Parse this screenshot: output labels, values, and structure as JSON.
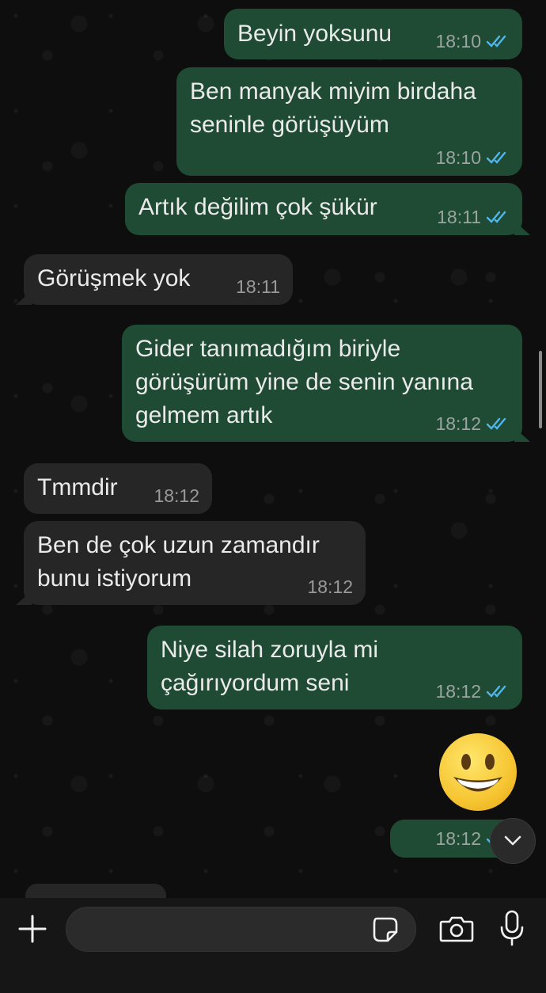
{
  "messages": [
    {
      "text": "Beyin yoksunu",
      "time": "18:10",
      "direction": "outgoing",
      "read": true
    },
    {
      "text": "Ben manyak miyim birdaha\nseninle görüşüyüm",
      "time": "18:10",
      "direction": "outgoing",
      "read": true
    },
    {
      "text": "Artık değilim çok şükür",
      "time": "18:11",
      "direction": "outgoing",
      "read": true
    },
    {
      "text": "Görüşmek yok",
      "time": "18:11",
      "direction": "incoming"
    },
    {
      "text": "Gider tanımadığım biriyle\ngörüşürüm yine de senin yanına\ngelmem artık",
      "time": "18:12",
      "direction": "outgoing",
      "read": true
    },
    {
      "text": "Tmmdir",
      "time": "18:12",
      "direction": "incoming"
    },
    {
      "text": "Ben de çok uzun zamandır\nbunu istiyorum",
      "time": "18:12",
      "direction": "incoming"
    },
    {
      "text": "Niye silah zoruyla mi\nçağırıyordum seni",
      "time": "18:12",
      "direction": "outgoing",
      "read": true
    },
    {
      "emoji": "grinning-face",
      "time": "18:12",
      "direction": "outgoing",
      "read": true
    }
  ],
  "composer": {
    "placeholder": "",
    "icons": [
      "plus-icon",
      "sticker-icon",
      "camera-icon",
      "microphone-icon"
    ]
  },
  "colors": {
    "outgoing_bubble": "#1f4a33",
    "incoming_bubble": "#262626",
    "read_ticks": "#4fb6ec",
    "background": "#0e0e0e"
  }
}
